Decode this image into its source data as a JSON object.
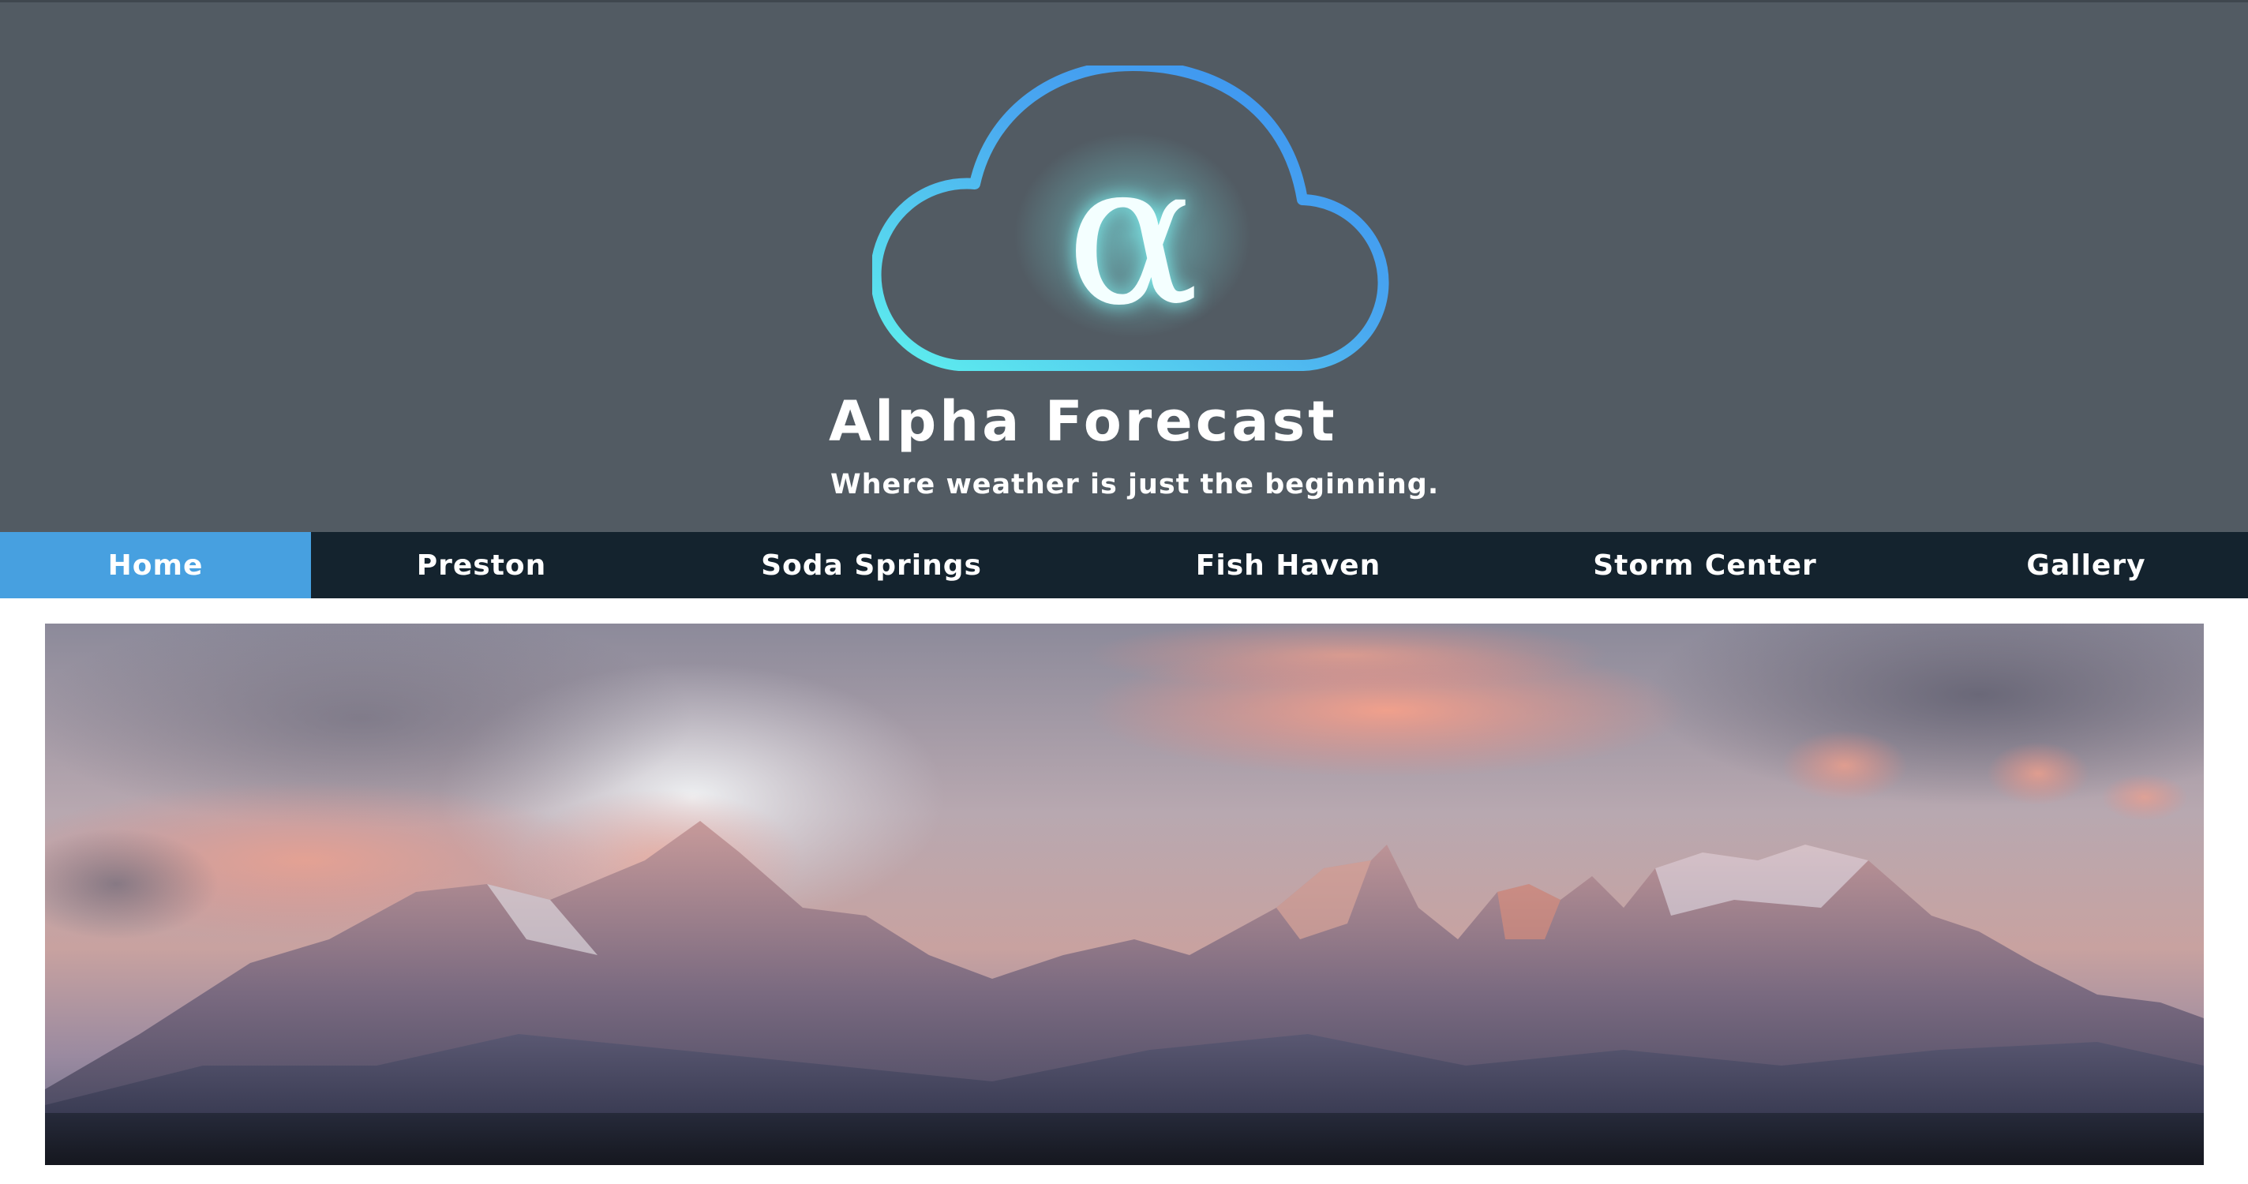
{
  "brand": {
    "logo_icon": "alpha-cloud-icon",
    "logo_glyph": "α",
    "title": "Alpha Forecast",
    "tagline": "Where weather is just the beginning."
  },
  "nav": {
    "items": [
      {
        "label": "Home",
        "active": true
      },
      {
        "label": "Preston",
        "active": false
      },
      {
        "label": "Soda Springs",
        "active": false
      },
      {
        "label": "Fish Haven",
        "active": false
      },
      {
        "label": "Storm Center",
        "active": false
      },
      {
        "label": "Gallery",
        "active": false
      }
    ]
  },
  "hero": {
    "image": "mountain-sunset-panorama"
  },
  "colors": {
    "header_bg": "#525b63",
    "nav_bg": "#14232e",
    "nav_active": "#47a0e0",
    "logo_gradient_start": "#5ef0ee",
    "logo_gradient_end": "#3a8ff0"
  }
}
